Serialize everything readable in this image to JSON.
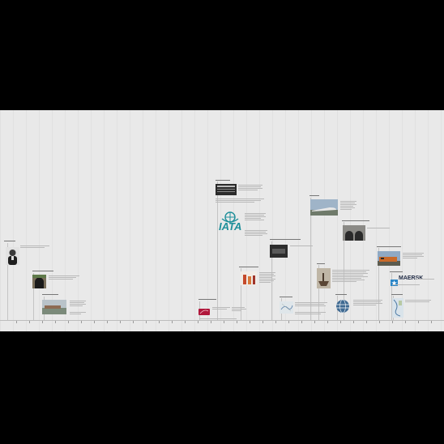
{
  "timeline": {
    "logos": {
      "iata": "IATA",
      "maersk": "MAERSK"
    },
    "colors": {
      "background": "#e9e9e9",
      "letterbox": "#000000",
      "iata_brand": "#1e8f9a",
      "maersk_brand": "#2a86c8",
      "sncf_brand": "#b0173b"
    }
  }
}
